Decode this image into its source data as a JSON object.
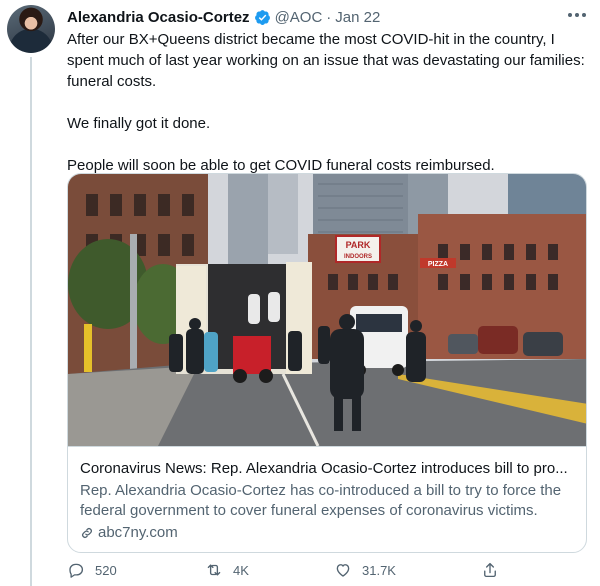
{
  "author": {
    "name": "Alexandria Ocasio-Cortez",
    "handle": "@AOC",
    "separator": "·",
    "date": "Jan 22",
    "verified": true
  },
  "text": {
    "paragraph1": "After our BX+Queens district became the most COVID-hit in the country, I spent much of last year working on an issue that was devastating our families: funeral costs.",
    "paragraph2": "We finally got it done.",
    "paragraph3": "People will soon be able to get COVID funeral costs reimbursed."
  },
  "card": {
    "title": "Coronavirus News: Rep. Alexandria Ocasio-Cortez introduces bill to pro...",
    "description": "Rep. Alexandria Ocasio-Cortez has co-introduced a bill to try to force the federal government to cover funeral expenses of coronavirus victims.",
    "domain": "abc7ny.com",
    "photo_signs": {
      "park": "PARK",
      "indoors": "INDOORS",
      "pizza": "PIZZA"
    }
  },
  "actions": {
    "reply_count": "520",
    "retweet_count": "4K",
    "like_count": "31.7K"
  },
  "colors": {
    "text_primary": "#0f1419",
    "text_secondary": "#536471",
    "border": "#cfd9de",
    "verified_blue": "#1d9bf0"
  },
  "icons": [
    "verified-badge-icon",
    "more-options-icon",
    "link-icon",
    "reply-icon",
    "retweet-icon",
    "like-icon",
    "share-icon"
  ]
}
